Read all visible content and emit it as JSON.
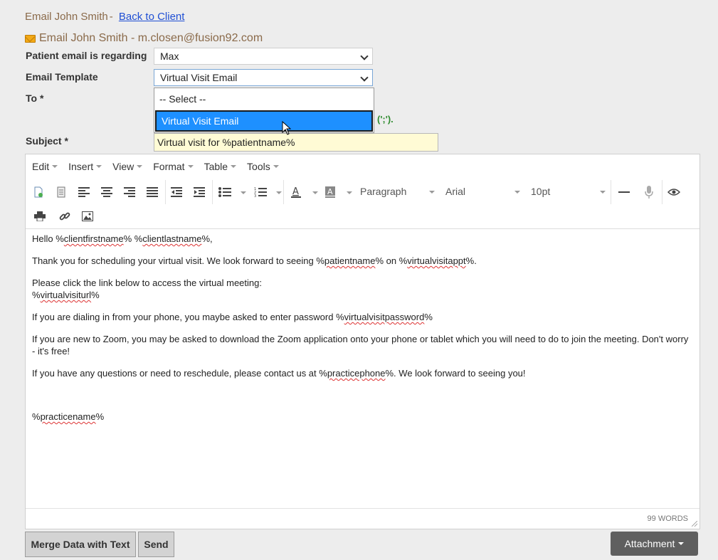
{
  "header": {
    "title": "Email John Smith",
    "separator": "-",
    "back_link": "Back to Client",
    "email_line": "Email John Smith - m.closen@fusion92.com"
  },
  "form": {
    "regarding_label": "Patient email is regarding",
    "regarding_value": "Max",
    "template_label": "Email Template",
    "template_value": "Virtual Visit Email",
    "template_options": [
      "-- Select --",
      "Virtual Visit Email"
    ],
    "to_label": "To *",
    "to_hint": "(';').",
    "subject_label": "Subject *",
    "subject_value": "Virtual visit for %patientname%"
  },
  "editor": {
    "menu": [
      "Edit",
      "Insert",
      "View",
      "Format",
      "Table",
      "Tools"
    ],
    "block_format": "Paragraph",
    "font_family": "Arial",
    "font_size": "10pt",
    "word_count": "99 WORDS",
    "body": {
      "p1_a": "Hello %",
      "p1_v1": "clientfirstname",
      "p1_b": "% %",
      "p1_v2": "clientlastname",
      "p1_c": "%,",
      "p2_a": "Thank you for scheduling your virtual visit. We look forward to seeing %",
      "p2_v1": "patientname",
      "p2_b": "% on %",
      "p2_v2": "virtualvisitappt",
      "p2_c": "%.",
      "p3_a": "Please click the link below to access the virtual meeting:",
      "p3_b": "%",
      "p3_v1": "virtualvisiturl",
      "p3_c": "%",
      "p4_a": "If you are dialing in from your phone, you maybe asked to enter password %",
      "p4_v1": "virtualvisitpassword",
      "p4_b": "%",
      "p5": "If you are new to Zoom, you may be asked to download the Zoom application onto your phone or tablet which you will need to do to join the meeting. Don't worry - it's free!",
      "p6_a": "If you have any questions or need to reschedule, please contact us at %",
      "p6_v1": "practicephone",
      "p6_b": "%. We look forward to seeing you!",
      "p7_a": "%",
      "p7_v1": "practicename",
      "p7_b": "%"
    }
  },
  "buttons": {
    "merge": "Merge Data with Text",
    "send": "Send",
    "attachment": "Attachment"
  },
  "colors": {
    "highlight": "#1e90ff",
    "link": "#1f4fd4",
    "subject_bg": "#fffbd5",
    "hint": "#2e8b2e",
    "heading": "#8a6a4a"
  }
}
